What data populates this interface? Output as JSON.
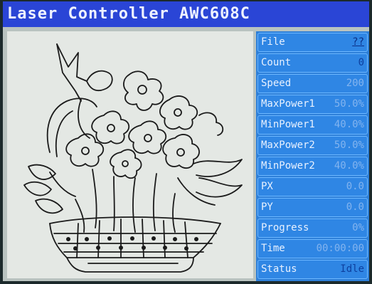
{
  "title": "Laser Controller AWC608C",
  "panel": {
    "rows": [
      {
        "label": "File",
        "value": "??"
      },
      {
        "label": "Count",
        "value": "0"
      },
      {
        "label": "Speed",
        "value": "200"
      },
      {
        "label": "MaxPower1",
        "value": "50.0%"
      },
      {
        "label": "MinPower1",
        "value": "40.0%"
      },
      {
        "label": "MaxPower2",
        "value": "50.0%"
      },
      {
        "label": "MinPower2",
        "value": "40.0%"
      },
      {
        "label": "PX",
        "value": "0.0"
      },
      {
        "label": "PY",
        "value": "0.0"
      },
      {
        "label": "Progress",
        "value": "0%"
      },
      {
        "label": "Time",
        "value": "00:00:00"
      },
      {
        "label": "Status",
        "value": "Idle"
      }
    ]
  },
  "colors": {
    "title_bar": "#2a45d6",
    "panel_bg": "#2d7fd8",
    "preview_bg": "#e4e8e4"
  },
  "preview": {
    "image_name": "flower-basket-drawing"
  }
}
